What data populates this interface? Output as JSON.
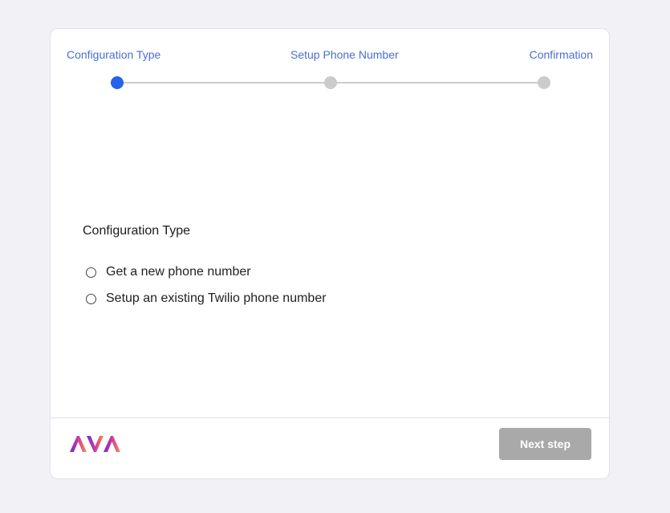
{
  "stepper": {
    "steps": [
      {
        "label": "Configuration Type",
        "active": true
      },
      {
        "label": "Setup Phone Number",
        "active": false
      },
      {
        "label": "Confirmation",
        "active": false
      }
    ],
    "active_color": "#2563eb",
    "inactive_color": "#cbcbcb",
    "label_color": "#4a6fd0"
  },
  "form": {
    "title": "Configuration Type",
    "options": [
      {
        "label": "Get a new phone number",
        "selected": false
      },
      {
        "label": "Setup an existing Twilio phone number",
        "selected": false
      }
    ]
  },
  "footer": {
    "logo": "AVA",
    "next_label": "Next step",
    "next_disabled": true
  }
}
